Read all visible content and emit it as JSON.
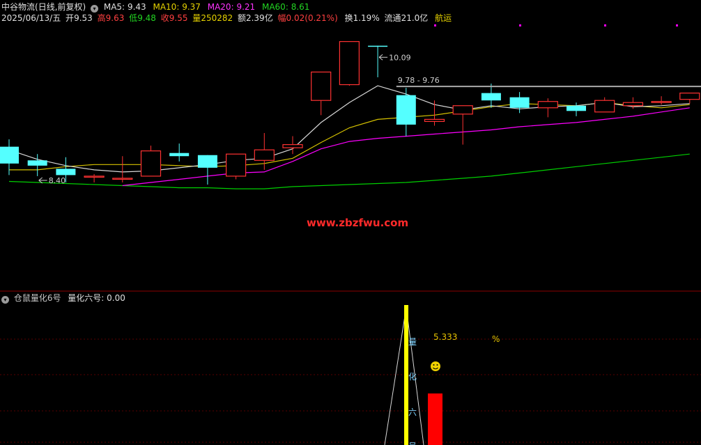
{
  "header": {
    "stock_name": "中谷物流",
    "mode": "(日线,前复权)",
    "ma5_label": "MA5:",
    "ma5": "9.43",
    "ma10_label": "MA10:",
    "ma10": "9.37",
    "ma20_label": "MA20:",
    "ma20": "9.21",
    "ma60_label": "MA60:",
    "ma60": "8.61",
    "date": "2025/06/13/五",
    "open_label": "开",
    "open": "9.53",
    "high_label": "高",
    "high": "9.63",
    "low_label": "低",
    "low": "9.48",
    "close_label": "收",
    "close": "9.55",
    "vol_label": "量",
    "vol": "250282",
    "amount_label": "额",
    "amount": "2.39亿",
    "chg_label": "幅",
    "chg": "0.02(0.21%)",
    "turnover_label": "换",
    "turnover": "1.19%",
    "float_label": "流通",
    "float": "21.0亿",
    "sector": "航运"
  },
  "indicator": {
    "title": "仓鼠量化6号",
    "label": "量化六号:",
    "value": "0.00",
    "annot_value": "5.333",
    "annot_unit": "%",
    "vertical_text": [
      "量",
      "化",
      "六",
      "号"
    ]
  },
  "watermark": "www.zbzfwu.com",
  "colors": {
    "up": "#ff3232",
    "down": "#54ffff",
    "ma5": "#d8d8d8",
    "ma10": "#d6c200",
    "ma20": "#ff00ff",
    "ma60": "#00d000",
    "grid": "#6b0000",
    "indicator": "#ffff00"
  },
  "chart_data": {
    "type": "candlestick",
    "ylim": [
      7.9,
      10.35
    ],
    "candles": [
      {
        "o": 9.22,
        "h": 9.29,
        "l": 8.95,
        "c": 9.06
      },
      {
        "o": 9.09,
        "h": 9.15,
        "l": 8.94,
        "c": 9.04
      },
      {
        "o": 9.01,
        "h": 9.12,
        "l": 8.88,
        "c": 8.95
      },
      {
        "o": 8.93,
        "h": 8.96,
        "l": 8.88,
        "c": 8.94
      },
      {
        "o": 8.92,
        "h": 9.13,
        "l": 8.88,
        "c": 8.92
      },
      {
        "o": 8.94,
        "h": 9.23,
        "l": 8.94,
        "c": 9.18
      },
      {
        "o": 9.16,
        "h": 9.25,
        "l": 9.08,
        "c": 9.13
      },
      {
        "o": 9.14,
        "h": 9.14,
        "l": 8.86,
        "c": 9.02
      },
      {
        "o": 8.94,
        "h": 9.15,
        "l": 8.91,
        "c": 9.15
      },
      {
        "o": 9.09,
        "h": 9.35,
        "l": 9.0,
        "c": 9.19
      },
      {
        "o": 9.21,
        "h": 9.32,
        "l": 9.15,
        "c": 9.24
      },
      {
        "o": 9.66,
        "h": 9.91,
        "l": 9.52,
        "c": 9.93
      },
      {
        "o": 9.81,
        "h": 10.02,
        "l": 9.8,
        "c": 10.22
      },
      {
        "o": 10.18,
        "h": 10.09,
        "l": 9.88,
        "c": 10.17
      },
      {
        "o": 9.71,
        "h": 9.78,
        "l": 9.32,
        "c": 9.43
      },
      {
        "o": 9.46,
        "h": 9.66,
        "l": 9.42,
        "c": 9.48
      },
      {
        "o": 9.53,
        "h": 9.61,
        "l": 9.24,
        "c": 9.61
      },
      {
        "o": 9.73,
        "h": 9.82,
        "l": 9.59,
        "c": 9.66
      },
      {
        "o": 9.69,
        "h": 9.74,
        "l": 9.54,
        "c": 9.59
      },
      {
        "o": 9.59,
        "h": 9.68,
        "l": 9.5,
        "c": 9.65
      },
      {
        "o": 9.61,
        "h": 9.64,
        "l": 9.51,
        "c": 9.56
      },
      {
        "o": 9.55,
        "h": 9.69,
        "l": 9.56,
        "c": 9.66
      },
      {
        "o": 9.61,
        "h": 9.69,
        "l": 9.58,
        "c": 9.64
      },
      {
        "o": 9.64,
        "h": 9.7,
        "l": 9.62,
        "c": 9.65
      },
      {
        "o": 9.67,
        "h": 9.73,
        "l": 9.63,
        "c": 9.73
      }
    ],
    "ma5": [
      9.19,
      9.1,
      9.04,
      9.0,
      8.98,
      8.99,
      9.02,
      9.05,
      9.09,
      9.11,
      9.2,
      9.45,
      9.64,
      9.8,
      9.72,
      9.62,
      9.57,
      9.61,
      9.58,
      9.6,
      9.61,
      9.64,
      9.6,
      9.61,
      9.63
    ],
    "ma10": [
      9.0,
      9.0,
      9.03,
      9.05,
      9.05,
      9.05,
      9.04,
      9.03,
      9.04,
      9.06,
      9.11,
      9.26,
      9.4,
      9.48,
      9.5,
      9.52,
      9.56,
      9.6,
      9.63,
      9.62,
      9.61,
      9.64,
      9.61,
      9.59,
      9.62
    ],
    "ma20": [
      null,
      null,
      null,
      null,
      8.85,
      8.88,
      8.91,
      8.94,
      8.97,
      8.98,
      9.08,
      9.2,
      9.27,
      9.3,
      9.32,
      9.34,
      9.36,
      9.38,
      9.41,
      9.43,
      9.45,
      9.48,
      9.51,
      9.55,
      9.59
    ],
    "ma60": [
      8.89,
      8.88,
      8.87,
      8.86,
      8.85,
      8.84,
      8.83,
      8.83,
      8.82,
      8.82,
      8.84,
      8.85,
      8.86,
      8.87,
      8.88,
      8.9,
      8.92,
      8.94,
      8.97,
      9.0,
      9.03,
      9.06,
      9.09,
      9.12,
      9.15
    ],
    "annotations": [
      {
        "label": "10.09",
        "index": 13,
        "value": 10.09
      },
      {
        "label": "8.40",
        "index": 1,
        "value": 8.92
      }
    ],
    "level": {
      "label": "9.78 - 9.76",
      "from": 14,
      "value": 9.78
    },
    "indicator_bar": {
      "value": 5.333
    }
  }
}
